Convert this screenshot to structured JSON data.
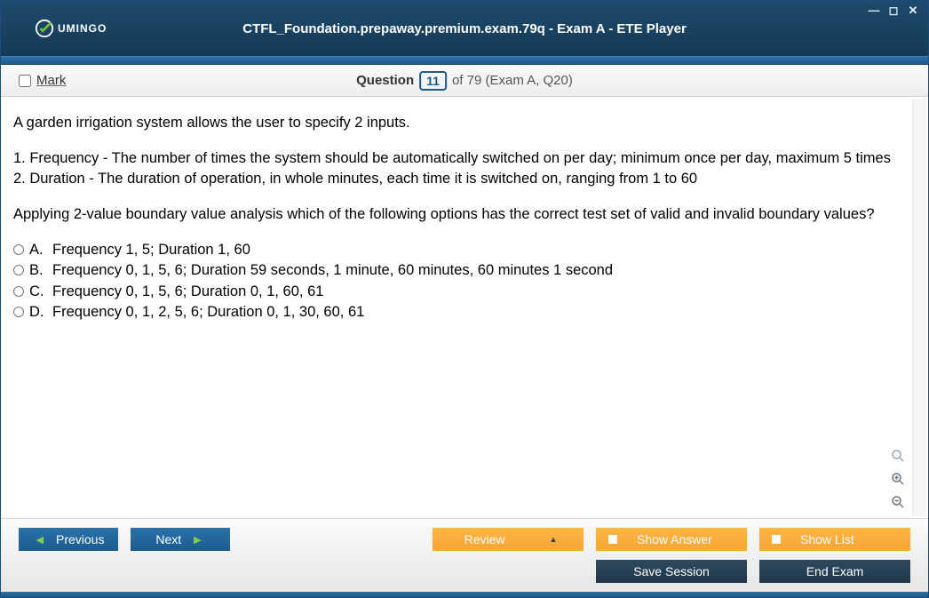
{
  "window": {
    "title": "CTFL_Foundation.prepaway.premium.exam.79q - Exam A - ETE Player",
    "brand": "UMINGO"
  },
  "header": {
    "mark_label": "Mark",
    "question_label": "Question",
    "question_number": "11",
    "question_total": "of 79 (Exam A, Q20)"
  },
  "question": {
    "intro": "A garden irrigation system allows the user to specify 2 inputs.",
    "line1": "1. Frequency - The number of times the system should be automatically switched on per day; minimum once per day, maximum 5 times",
    "line2": "2. Duration - The duration of operation, in whole minutes, each time it is switched on, ranging from 1 to 60",
    "prompt": "Applying 2-value boundary value analysis which of the following options has the correct test set of valid and invalid boundary values?",
    "options": [
      {
        "letter": "A.",
        "text": "Frequency 1, 5; Duration 1, 60"
      },
      {
        "letter": "B.",
        "text": "Frequency 0, 1, 5, 6; Duration 59 seconds, 1 minute, 60 minutes, 60 minutes 1 second"
      },
      {
        "letter": "C.",
        "text": "Frequency 0, 1, 5, 6; Duration 0, 1, 60, 61"
      },
      {
        "letter": "D.",
        "text": "Frequency 0, 1, 2, 5, 6; Duration 0, 1, 30, 60, 61"
      }
    ]
  },
  "buttons": {
    "previous": "Previous",
    "next": "Next",
    "review": "Review",
    "show_answer": "Show Answer",
    "show_list": "Show List",
    "save_session": "Save Session",
    "end_exam": "End Exam"
  }
}
